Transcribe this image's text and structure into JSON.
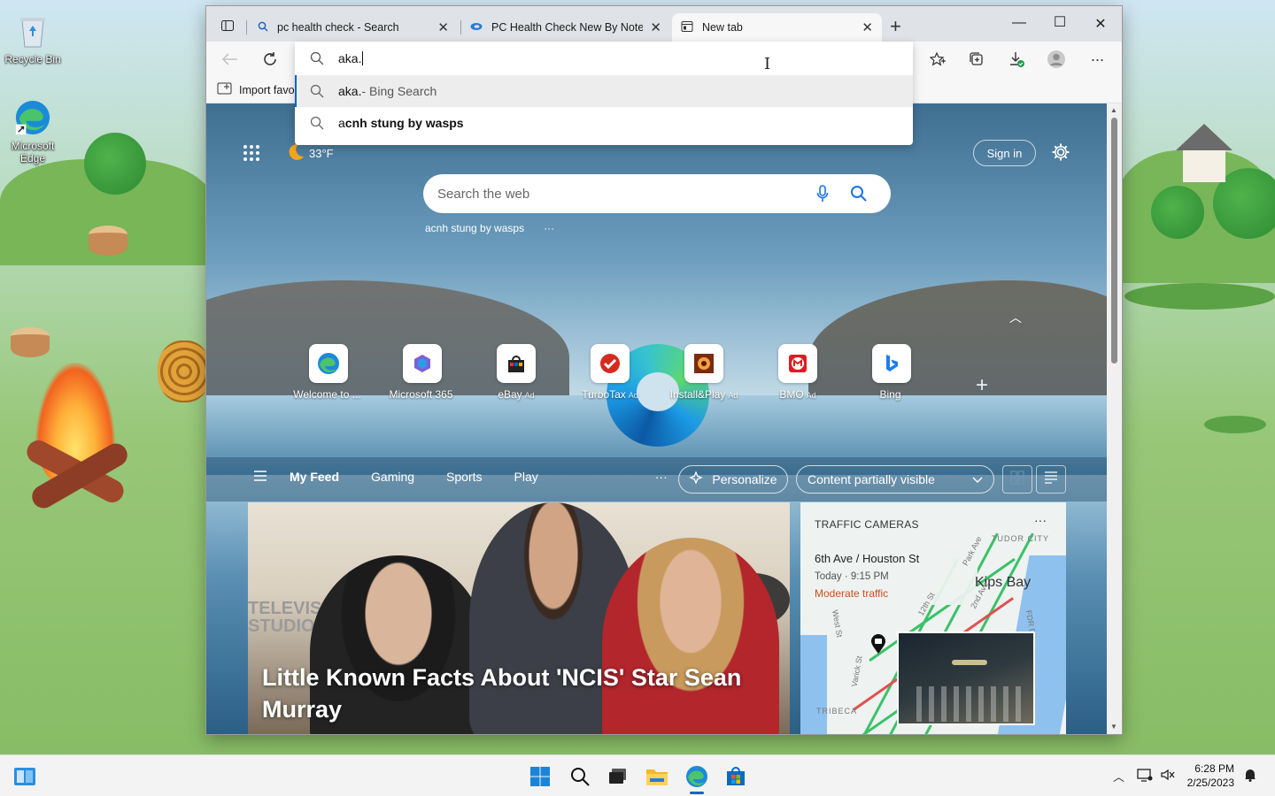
{
  "desktop": {
    "icons": [
      {
        "label": "Recycle Bin"
      },
      {
        "label": "Microsoft Edge"
      }
    ]
  },
  "browser": {
    "tabs": [
      {
        "title": "pc health check - Search",
        "icon": "search-icon"
      },
      {
        "title": "PC Health Check New By Notere",
        "icon": "edge-app-icon"
      },
      {
        "title": "New tab",
        "icon": "new-tab-page-icon"
      }
    ],
    "address_bar": {
      "value": "aka."
    },
    "omnibox_suggestions": [
      {
        "text": "aka.",
        "suffix": " - Bing Search",
        "selected": true
      },
      {
        "prefix": "a",
        "bold": "cnh stung by wasps",
        "selected": false
      }
    ],
    "favorites_bar": {
      "import_label": "Import favo"
    },
    "toolbar_icons": [
      "back-icon",
      "refresh-icon",
      "favorites-icon",
      "collections-icon",
      "downloads-icon",
      "profile-icon",
      "more-icon"
    ]
  },
  "ntp": {
    "weather": "33°F",
    "sign_in": "Sign in",
    "search_placeholder": "Search the web",
    "trending": "acnh stung by wasps",
    "trending_more": "···",
    "quick_links": [
      {
        "label": "Welcome to ...",
        "ad": ""
      },
      {
        "label": "Microsoft 365",
        "ad": ""
      },
      {
        "label": "eBay",
        "ad": "Ad"
      },
      {
        "label": "TurboTax",
        "ad": "Ad"
      },
      {
        "label": "Install&Play",
        "ad": "Ad"
      },
      {
        "label": "BMO",
        "ad": "Ad"
      },
      {
        "label": "Bing",
        "ad": ""
      }
    ],
    "feed_nav": [
      "My Feed",
      "Gaming",
      "Sports",
      "Play"
    ],
    "feed_more": "···",
    "personalize": "Personalize",
    "content_visibility": "Content partially visible",
    "main_card": {
      "title": "Little Known Facts About 'NCIS' Star Sean Murray",
      "bg_text_1": "TELEVISION",
      "bg_text_2": "STUDIOS"
    },
    "traffic_card": {
      "heading": "TRAFFIC CAMERAS",
      "more": "···",
      "location": "6th Ave / Houston St",
      "time": "Today · 9:15 PM",
      "status": "Moderate traffic",
      "map_labels": {
        "kips_bay": "Kips Bay",
        "tudor_city": "TUDOR CITY",
        "tribeca": "TRIBECA",
        "park_ave": "Park Ave",
        "second_ave": "2nd Ave",
        "varick": "Varick St",
        "twelfth": "12th St",
        "fdr": "FDR Dr",
        "west": "West St"
      }
    }
  },
  "taskbar": {
    "time": "6:28 PM",
    "date": "2/25/2023"
  },
  "colors": {
    "accent": "#0067c0",
    "traffic_status": "#c8501c"
  }
}
